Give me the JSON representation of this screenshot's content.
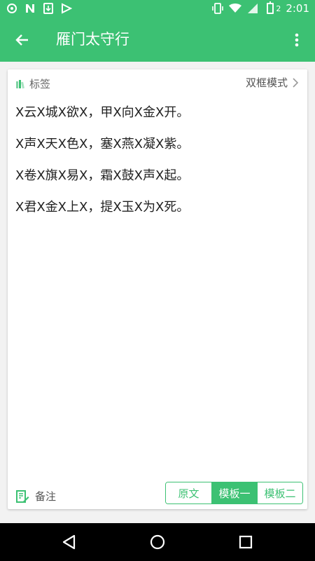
{
  "status_bar": {
    "time": "2:01",
    "battery_level": "2",
    "left_icons": [
      "sync-icon",
      "n-icon",
      "download-icon",
      "play-store-icon"
    ],
    "right_icons": [
      "vibrate-icon",
      "wifi-icon",
      "signal-icon",
      "battery-icon"
    ]
  },
  "app_bar": {
    "title": "雁门太守行"
  },
  "card": {
    "tag_label": "标签",
    "mode_label": "双框模式",
    "poem_lines": [
      "X云X城X欲X，甲X向X金X开。",
      "X声X天X色X，塞X燕X凝X紫。",
      "X卷X旗X易X，霜X鼓X声X起。",
      "X君X金X上X，提X玉X为X死。"
    ],
    "note_label": "备注",
    "segments": [
      {
        "label": "原文",
        "active": false
      },
      {
        "label": "模板一",
        "active": true
      },
      {
        "label": "模板二",
        "active": false
      }
    ]
  },
  "colors": {
    "accent": "#3cc173",
    "text": "#222222",
    "muted": "#666666"
  }
}
